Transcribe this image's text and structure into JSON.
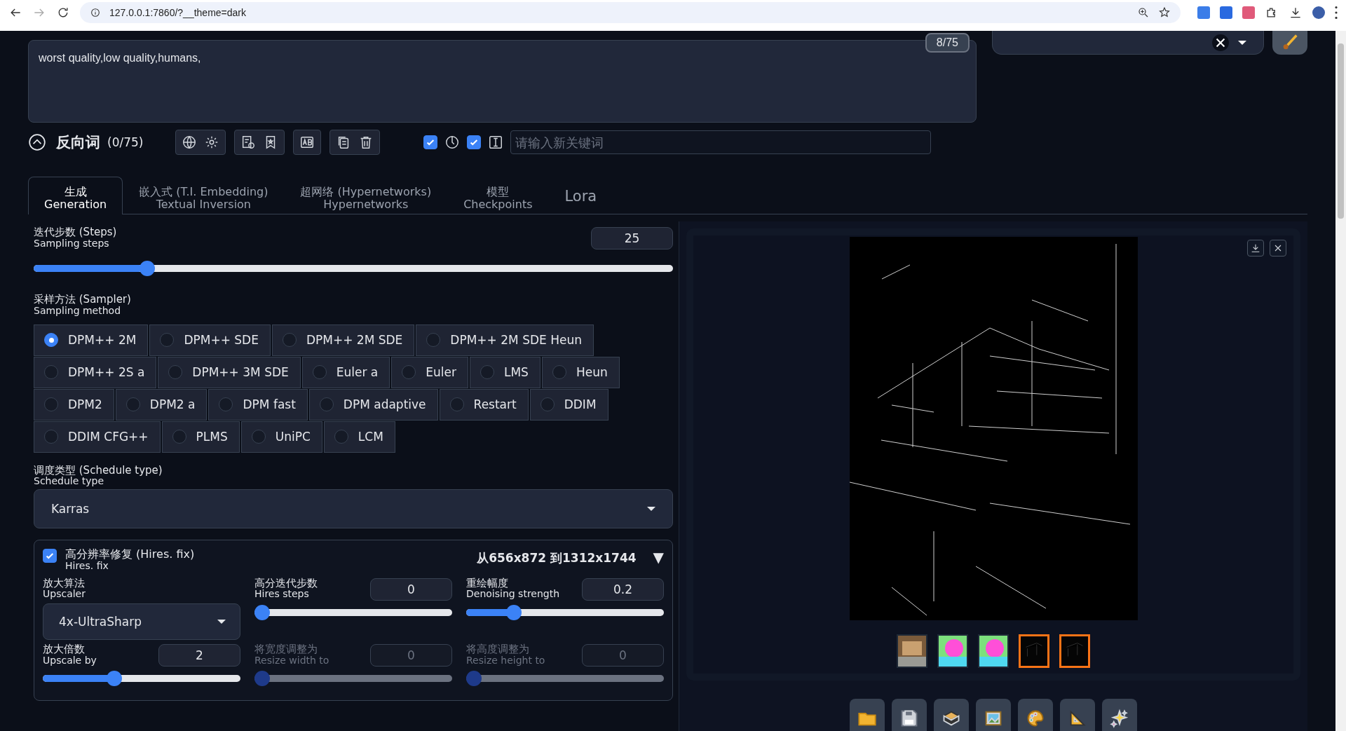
{
  "browser": {
    "url": "127.0.0.1:7860/?__theme=dark"
  },
  "prompt": {
    "text": "worst quality,low quality,humans,",
    "token_count": "8/75"
  },
  "negative_bar": {
    "title": "反向词",
    "token_count": "(0/75)",
    "toggles": [
      {
        "checked": true
      },
      {
        "checked": true
      }
    ],
    "keyword_placeholder": "请输入新关键词"
  },
  "tabs": [
    {
      "label": "生成",
      "sublabel": "Generation",
      "selected": true
    },
    {
      "label": "嵌入式 (T.I. Embedding)",
      "sublabel": "Textual Inversion",
      "selected": false
    },
    {
      "label": "超网络 (Hypernetworks)",
      "sublabel": "Hypernetworks",
      "selected": false
    },
    {
      "label": "模型",
      "sublabel": "Checkpoints",
      "selected": false
    },
    {
      "label": "Lora",
      "selected": false
    }
  ],
  "steps": {
    "label": "迭代步数 (Steps)",
    "sublabel": "Sampling steps",
    "value": "25",
    "level": 0.17
  },
  "sampler": {
    "label": "采样方法 (Sampler)",
    "sublabel": "Sampling method",
    "options": [
      {
        "label": "DPM++ 2M",
        "selected": true
      },
      {
        "label": "DPM++ SDE",
        "selected": false
      },
      {
        "label": "DPM++ 2M SDE",
        "selected": false
      },
      {
        "label": "DPM++ 2M SDE Heun",
        "selected": false
      },
      {
        "label": "DPM++ 2S a",
        "selected": false
      },
      {
        "label": "DPM++ 3M SDE",
        "selected": false
      },
      {
        "label": "Euler a",
        "selected": false
      },
      {
        "label": "Euler",
        "selected": false
      },
      {
        "label": "LMS",
        "selected": false
      },
      {
        "label": "Heun",
        "selected": false
      },
      {
        "label": "DPM2",
        "selected": false
      },
      {
        "label": "DPM2 a",
        "selected": false
      },
      {
        "label": "DPM fast",
        "selected": false
      },
      {
        "label": "DPM adaptive",
        "selected": false
      },
      {
        "label": "Restart",
        "selected": false
      },
      {
        "label": "DDIM",
        "selected": false
      },
      {
        "label": "DDIM CFG++",
        "selected": false
      },
      {
        "label": "PLMS",
        "selected": false
      },
      {
        "label": "UniPC",
        "selected": false
      },
      {
        "label": "LCM",
        "selected": false
      }
    ]
  },
  "schedule": {
    "label": "调度类型 (Schedule type)",
    "sublabel": "Schedule type",
    "value": "Karras"
  },
  "hires_fix": {
    "checked": true,
    "label": "高分辨率修复 (Hires. fix)",
    "sublabel": "Hires. fix",
    "summary": "从656x872 到1312x1744",
    "toggle": "▼",
    "upscaler": {
      "label": "放大算法",
      "sublabel": "Upscaler",
      "value": "4x-UltraSharp"
    },
    "params": [
      {
        "label": "高分迭代步数",
        "sublabel": "Hires steps",
        "value": "0",
        "level": 0,
        "disabled": false
      },
      {
        "label": "重绘幅度",
        "sublabel": "Denoising strength",
        "value": "0.2",
        "level": 0.22,
        "disabled": false
      },
      {
        "label": "放大倍数",
        "sublabel": "Upscale by",
        "value": "2",
        "level": 0.35,
        "disabled": false
      },
      {
        "label": "将宽度调整为",
        "sublabel": "Resize width to",
        "value": "0",
        "level": 0,
        "disabled": true
      },
      {
        "label": "将高度调整为",
        "sublabel": "Resize height to",
        "value": "0",
        "level": 0,
        "disabled": true
      }
    ]
  },
  "gallery": {
    "thumbnails": [
      {
        "kind": "photo",
        "selected": false
      },
      {
        "kind": "segmentation",
        "selected": false
      },
      {
        "kind": "segmentation",
        "selected": false
      },
      {
        "kind": "edges",
        "selected": true
      },
      {
        "kind": "edges",
        "selected": true
      }
    ]
  }
}
